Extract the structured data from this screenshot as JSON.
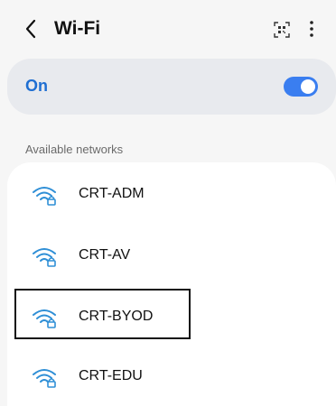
{
  "header": {
    "title": "Wi-Fi",
    "back_icon": "chevron-left-icon",
    "qr_icon": "qr-scan-icon",
    "more_icon": "more-vertical-icon"
  },
  "wifi_toggle": {
    "label": "On",
    "state": "on",
    "accent_color": "#3a7ef0",
    "label_color": "#1f6fd2"
  },
  "available_networks": {
    "header": "Available networks",
    "icon": "wifi-lock-icon",
    "icon_color": "#2f8fd6",
    "items": [
      {
        "name": "CRT-ADM"
      },
      {
        "name": "CRT-AV"
      },
      {
        "name": "CRT-BYOD",
        "highlighted": true
      },
      {
        "name": "CRT-EDU"
      }
    ]
  }
}
